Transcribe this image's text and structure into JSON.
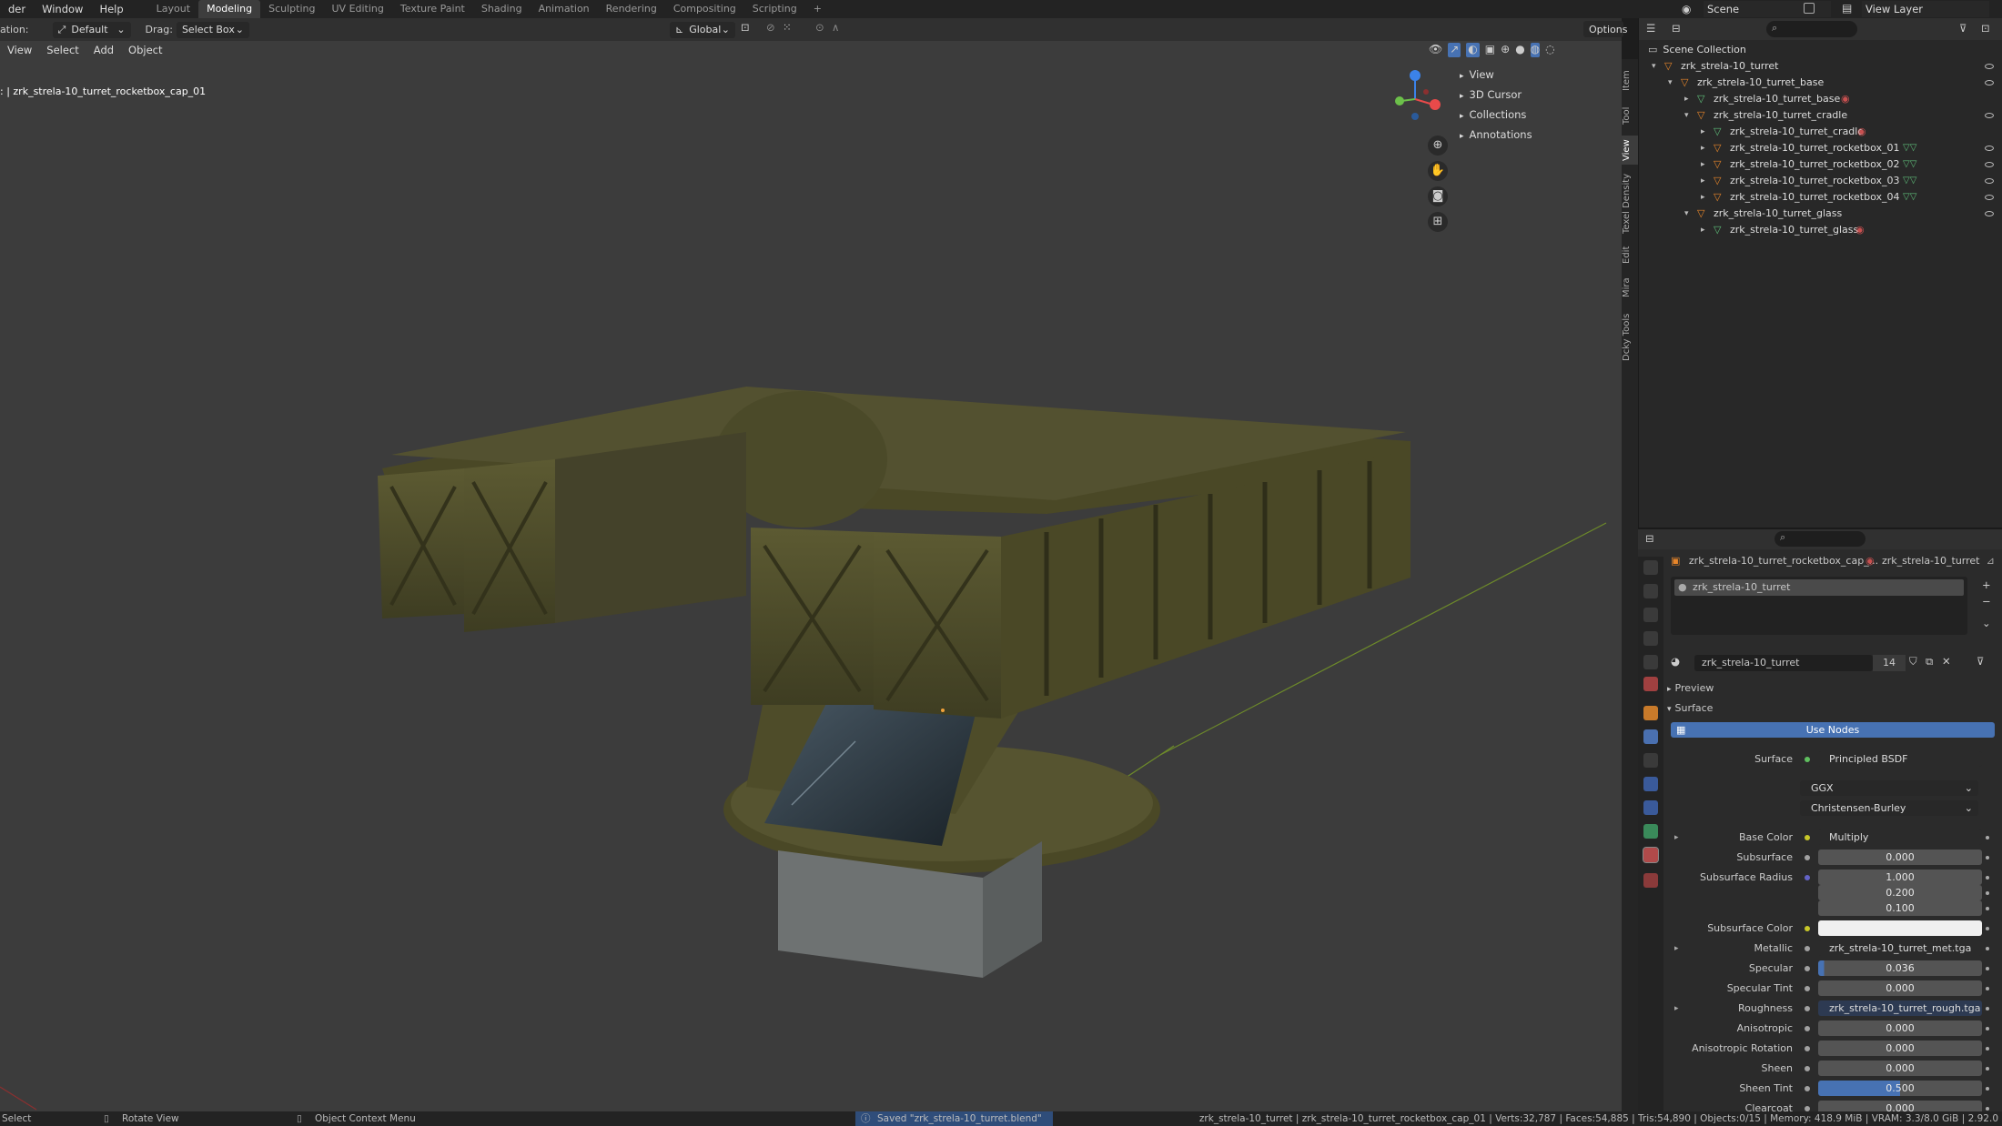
{
  "topbar": {
    "menus": [
      "der",
      "Window",
      "Help"
    ],
    "workspaces": [
      "Layout",
      "Modeling",
      "Sculpting",
      "UV Editing",
      "Texture Paint",
      "Shading",
      "Animation",
      "Rendering",
      "Compositing",
      "Scripting"
    ],
    "active_workspace": "Modeling",
    "add_tab": "+",
    "scene": "Scene",
    "view_layer": "View Layer"
  },
  "header2": {
    "orientation_label": "ation:",
    "orientation_value": "Default",
    "drag_label": "Drag:",
    "drag_value": "Select Box",
    "transform_value": "Global",
    "options_label": "Options"
  },
  "viewport_menu": [
    "View",
    "Select",
    "Add",
    "Object"
  ],
  "viewport": {
    "active_object_text": ": | zrk_strela-10_turret_rocketbox_cap_01",
    "npanel_items": [
      "View",
      "3D Cursor",
      "Collections",
      "Annotations"
    ],
    "sidebar_tabs": [
      "Item",
      "Tool",
      "View",
      "Texel Density",
      "Edit",
      "Mira",
      "Dcky Tools"
    ]
  },
  "outliner": {
    "root": "Scene Collection",
    "rows": [
      {
        "label": "zrk_strela-10_turret",
        "indent": 0
      },
      {
        "label": "zrk_strela-10_turret_base",
        "indent": 1
      },
      {
        "label": "zrk_strela-10_turret_base",
        "indent": 2
      },
      {
        "label": "zrk_strela-10_turret_cradle",
        "indent": 2
      },
      {
        "label": "zrk_strela-10_turret_cradle",
        "indent": 3
      },
      {
        "label": "zrk_strela-10_turret_rocketbox_01",
        "indent": 3
      },
      {
        "label": "zrk_strela-10_turret_rocketbox_02",
        "indent": 3
      },
      {
        "label": "zrk_strela-10_turret_rocketbox_03",
        "indent": 3
      },
      {
        "label": "zrk_strela-10_turret_rocketbox_04",
        "indent": 3
      },
      {
        "label": "zrk_strela-10_turret_glass",
        "indent": 2
      },
      {
        "label": "zrk_strela-10_turret_glass",
        "indent": 3
      }
    ]
  },
  "properties": {
    "object_name": "zrk_strela-10_turret_rocketbox_cap_...",
    "material_name_header": "zrk_strela-10_turret",
    "slot_name": "zrk_strela-10_turret",
    "material_field": "zrk_strela-10_turret",
    "user_count": "14",
    "preview": "Preview",
    "surface_panel": "Surface",
    "use_nodes": "Use Nodes",
    "surface_label": "Surface",
    "surface_value": "Principled BSDF",
    "distribution": "GGX",
    "subsurface_method": "Christensen-Burley",
    "rows": [
      {
        "label": "Base Color",
        "value": "Multiply"
      },
      {
        "label": "Subsurface",
        "value": "0.000"
      },
      {
        "label": "Subsurface Radius",
        "value": "1.000"
      },
      {
        "label": "",
        "value": "0.200"
      },
      {
        "label": "",
        "value": "0.100"
      },
      {
        "label": "Subsurface Color",
        "value": ""
      },
      {
        "label": "Metallic",
        "value": "zrk_strela-10_turret_met.tga"
      },
      {
        "label": "Specular",
        "value": "0.036"
      },
      {
        "label": "Specular Tint",
        "value": "0.000"
      },
      {
        "label": "Roughness",
        "value": "zrk_strela-10_turret_rough.tga"
      },
      {
        "label": "Anisotropic",
        "value": "0.000"
      },
      {
        "label": "Anisotropic Rotation",
        "value": "0.000"
      },
      {
        "label": "Sheen",
        "value": "0.000"
      },
      {
        "label": "Sheen Tint",
        "value": "0.500"
      },
      {
        "label": "Clearcoat",
        "value": "0.000"
      }
    ],
    "specular_fill": 0.036,
    "sheen_tint_fill": 0.5
  },
  "statusbar": {
    "select": "Select",
    "rotate": "Rotate View",
    "context": "Object Context Menu",
    "saved": "Saved \"zrk_strela-10_turret.blend\"",
    "stats": "zrk_strela-10_turret | zrk_strela-10_turret_rocketbox_cap_01 | Verts:32,787 | Faces:54,885 | Tris:54,890 | Objects:0/15 | Memory: 418.9 MiB | VRAM: 3.3/8.0 GiB | 2.92.0"
  },
  "colors": {
    "accent": "#4772b3",
    "header": "#303030",
    "viewport_bg": "#3c3c3c",
    "mesh_icon": "#e8862a",
    "vert_icon": "#5fbf7a",
    "material_icon": "#c85050"
  }
}
